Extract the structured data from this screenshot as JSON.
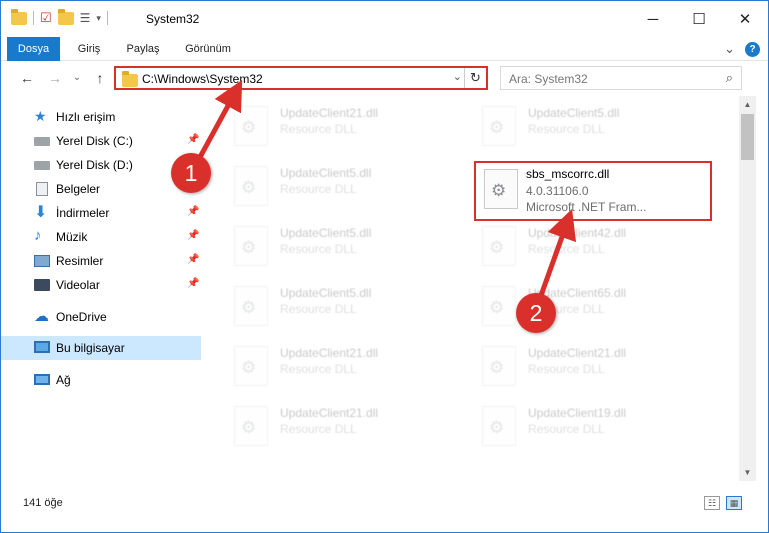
{
  "window": {
    "title": "System32",
    "controls": {
      "minimize": "─",
      "maximize": "☐",
      "close": "✕"
    }
  },
  "ribbon": {
    "tabs": [
      "Dosya",
      "Giriş",
      "Paylaş",
      "Görünüm"
    ],
    "expand": "⌄",
    "help": "?"
  },
  "navigation": {
    "back": "←",
    "forward": "→",
    "recent": "⌄",
    "up": "↑",
    "address": "C:\\Windows\\System32",
    "address_dropdown": "⌄",
    "refresh": "↻",
    "search_placeholder": "Ara: System32",
    "search_icon": "⌕"
  },
  "sidebar": {
    "items": [
      {
        "label": "Hızlı erişim",
        "icon": "star-icon",
        "pinned": false
      },
      {
        "label": "Yerel Disk (C:)",
        "icon": "drive-icon",
        "pinned": true
      },
      {
        "label": "Yerel Disk (D:)",
        "icon": "drive-icon",
        "pinned": false
      },
      {
        "label": "Belgeler",
        "icon": "documents-icon",
        "pinned": true
      },
      {
        "label": "İndirmeler",
        "icon": "download-icon",
        "pinned": true
      },
      {
        "label": "Müzik",
        "icon": "music-icon",
        "pinned": true
      },
      {
        "label": "Resimler",
        "icon": "pictures-icon",
        "pinned": true
      },
      {
        "label": "Videolar",
        "icon": "videos-icon",
        "pinned": true
      },
      {
        "label": "OneDrive",
        "icon": "cloud-icon",
        "pinned": false
      },
      {
        "label": "Bu bilgisayar",
        "icon": "computer-icon",
        "pinned": false,
        "selected": true
      },
      {
        "label": "Ağ",
        "icon": "network-icon",
        "pinned": false
      }
    ],
    "pin_glyph": "📌"
  },
  "files": {
    "left_column": [
      {
        "name": "UpdateClient21.dll",
        "type": "Resource DLL"
      },
      {
        "name": "UpdateClient5.dll",
        "type": "Resource DLL"
      },
      {
        "name": "UpdateClient5.dll",
        "type": "Resource DLL"
      },
      {
        "name": "UpdateClient5.dll",
        "type": "Resource DLL"
      },
      {
        "name": "UpdateClient21.dll",
        "type": "Resource DLL"
      },
      {
        "name": "UpdateClient21.dll",
        "type": "Resource DLL"
      }
    ],
    "right_column": [
      {
        "name": "UpdateClient5.dll",
        "type": "Resource DLL"
      },
      {
        "name": "sbs_mscorrc.dll",
        "version": "4.0.31106.0",
        "type": "Microsoft .NET Fram...",
        "highlighted": true
      },
      {
        "name": "UpdateClient42.dll",
        "type": "Resource DLL"
      },
      {
        "name": "UpdateClient65.dll",
        "type": "Resource DLL"
      },
      {
        "name": "UpdateClient21.dll",
        "type": "Resource DLL"
      },
      {
        "name": "UpdateClient19.dll",
        "type": "Resource DLL"
      }
    ]
  },
  "status": {
    "item_count": "141 öğe"
  },
  "annotations": {
    "marker1": "1",
    "marker2": "2",
    "color": "#d9302c"
  },
  "colors": {
    "accent": "#1979ca",
    "selection": "#cce8ff",
    "highlight": "#d9302c"
  }
}
